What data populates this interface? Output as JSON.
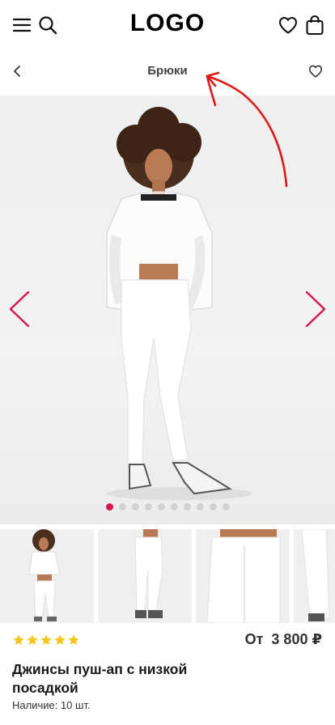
{
  "header": {
    "logo": "LOGO",
    "menu_icon": "menu-icon",
    "search_icon": "search-icon",
    "favorites_icon": "heart-icon",
    "cart_icon": "shopping-bag-icon"
  },
  "subbar": {
    "title": "Брюки",
    "back_icon": "chevron-left-icon",
    "favorite_icon": "heart-icon"
  },
  "gallery": {
    "prev_icon": "chevron-left-icon",
    "next_icon": "chevron-right-icon",
    "slide_count": 10,
    "active_slide": 1,
    "thumbnails": [
      "full-length-front",
      "legs-side",
      "back-closeup",
      "legs-partial"
    ]
  },
  "product": {
    "rating": 5,
    "rating_max": 5,
    "price_prefix": "От",
    "price": "3 800 ₽",
    "name": "Джинсы пуш-ап с низкой посадкой",
    "stock": "Наличие: 10 шт."
  },
  "colors": {
    "accent": "#d5174b",
    "star": "#f5c518",
    "annotation": "#e01818"
  }
}
